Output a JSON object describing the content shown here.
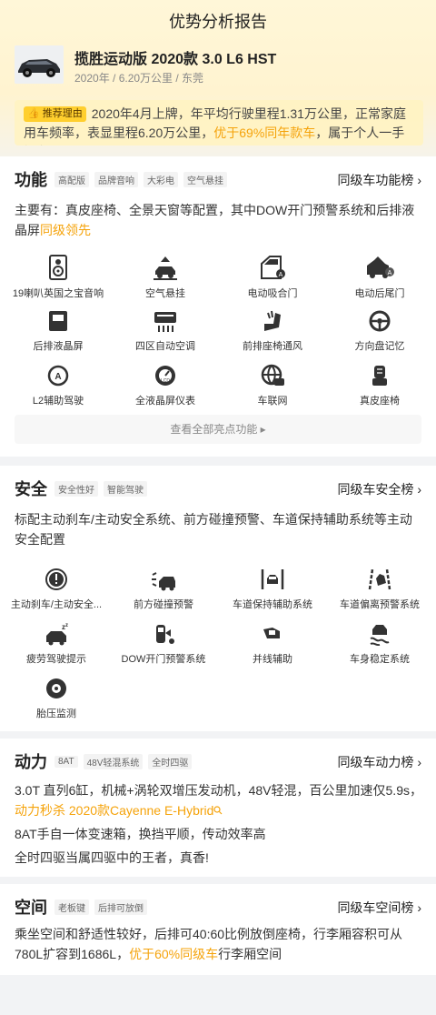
{
  "page_title": "优势分析报告",
  "car": {
    "name": "揽胜运动版 2020款 3.0 L6 HST",
    "meta": "2020年 / 6.20万公里 / 东莞"
  },
  "recommend": {
    "tag": "推荐理由",
    "text_before": "2020年4月上牌，年平均行驶里程1.31万公里，正常家庭用车频率，表显里程6.20万公里，",
    "highlight": "优于69%同年款车",
    "text_after": "，属于个人一手好车"
  },
  "function": {
    "title": "功能",
    "tags": [
      "高配版",
      "品牌音响",
      "大彩电",
      "空气悬挂"
    ],
    "rank_link": "同级车功能榜 ›",
    "desc": "主要有：真皮座椅、全景天窗等配置，其中DOW开门预警系统和后排液晶屏",
    "desc_hl": "同级领先",
    "features": [
      {
        "label": "19喇叭英国之宝音响",
        "icon": "speaker-icon"
      },
      {
        "label": "空气悬挂",
        "icon": "air-suspension-icon"
      },
      {
        "label": "电动吸合门",
        "icon": "power-door-icon"
      },
      {
        "label": "电动后尾门",
        "icon": "power-tailgate-icon"
      },
      {
        "label": "后排液晶屏",
        "icon": "rear-screen-icon"
      },
      {
        "label": "四区自动空调",
        "icon": "climate-icon"
      },
      {
        "label": "前排座椅通风",
        "icon": "seat-ventilation-icon"
      },
      {
        "label": "方向盘记忆",
        "icon": "steering-memory-icon"
      },
      {
        "label": "L2辅助驾驶",
        "icon": "l2-assist-icon"
      },
      {
        "label": "全液晶屏仪表",
        "icon": "lcd-cluster-icon"
      },
      {
        "label": "车联网",
        "icon": "connected-car-icon"
      },
      {
        "label": "真皮座椅",
        "icon": "leather-seat-icon"
      }
    ],
    "view_all": "查看全部亮点功能 ▸"
  },
  "safety": {
    "title": "安全",
    "tags": [
      "安全性好",
      "智能驾驶"
    ],
    "rank_link": "同级车安全榜 ›",
    "desc": "标配主动刹车/主动安全系统、前方碰撞预警、车道保持辅助系统等主动安全配置",
    "features": [
      {
        "label": "主动刹车/主动安全...",
        "icon": "active-brake-icon"
      },
      {
        "label": "前方碰撞预警",
        "icon": "collision-warning-icon"
      },
      {
        "label": "车道保持辅助系统",
        "icon": "lane-keep-icon"
      },
      {
        "label": "车道偏离预警系统",
        "icon": "lane-departure-icon"
      },
      {
        "label": "疲劳驾驶提示",
        "icon": "fatigue-icon"
      },
      {
        "label": "DOW开门预警系统",
        "icon": "dow-icon"
      },
      {
        "label": "并线辅助",
        "icon": "blind-spot-icon"
      },
      {
        "label": "车身稳定系统",
        "icon": "stability-icon"
      },
      {
        "label": "胎压监测",
        "icon": "tire-pressure-icon"
      }
    ]
  },
  "power": {
    "title": "动力",
    "tags": [
      "8AT",
      "48V轻混系统",
      "全时四驱"
    ],
    "rank_link": "同级车动力榜 ›",
    "p1_before": "3.0T 直列6缸，机械+涡轮双增压发动机，48V轻混，百公里加速仅5.9s，",
    "p1_hl": "动力秒杀 2020款Cayenne E-Hybrid",
    "p1_icon": "search-icon",
    "p2": "8AT手自一体变速箱，换挡平顺，传动效率高",
    "p3": "全时四驱当属四驱中的王者，真香!"
  },
  "space": {
    "title": "空间",
    "tags": [
      "老板键",
      "后排可放倒"
    ],
    "rank_link": "同级车空间榜 ›",
    "p1_before": "乘坐空间和舒适性较好，后排可40:60比例放倒座椅，行李厢容积可从780L扩容到1686L，",
    "p1_hl": "优于60%同级车",
    "p1_after": "行李厢空间"
  },
  "colors": {
    "accent": "#f5a30b",
    "tag_bg": "#ffcf2e",
    "header_bg": "#fff7d8"
  }
}
